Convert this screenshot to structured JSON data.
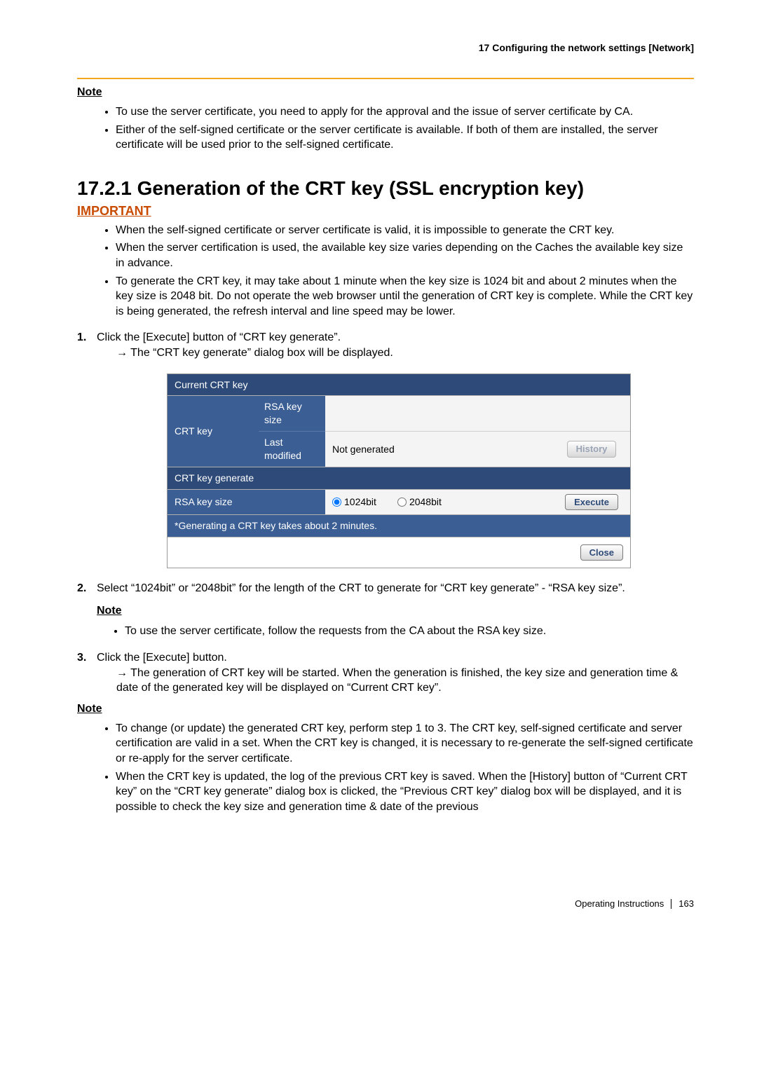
{
  "header": {
    "chapter": "17 Configuring the network settings [Network]"
  },
  "noteTop": {
    "heading": "Note",
    "items": [
      "To use the server certificate, you need to apply for the approval and the issue of server certificate by CA.",
      "Either of the self-signed certificate or the server certificate is available. If both of them are installed, the server certificate will be used prior to the self-signed certificate."
    ]
  },
  "section": {
    "number_title": "17.2.1  Generation of the CRT key (SSL encryption key)",
    "important": "IMPORTANT",
    "importantItems": [
      "When the self-signed certificate or server certificate is valid, it is impossible to generate the CRT key.",
      "When the server certification is used, the available key size varies depending on the Caches the available key size in advance.",
      "To generate the CRT key, it may take about 1 minute when the key size is 1024 bit and about 2 minutes when the key size is 2048 bit. Do not operate the web browser until the generation of CRT key is complete. While the CRT key is being generated, the refresh interval and line speed may be lower."
    ]
  },
  "step1": {
    "text": "Click the [Execute] button of “CRT key generate”.",
    "arrow": "The “CRT key generate” dialog box will be displayed."
  },
  "dialog": {
    "title": "Current CRT key",
    "rowLabel": "CRT key",
    "sub1": "RSA key size",
    "sub2": "Last modified",
    "val1": "",
    "val2": "Not generated",
    "historyBtn": "History",
    "genTitle": "CRT key generate",
    "rsaLabel": "RSA key size",
    "opt1": "1024bit",
    "opt2": "2048bit",
    "execBtn": "Execute",
    "genNote": "*Generating a CRT key takes about 2 minutes.",
    "closeBtn": "Close"
  },
  "step2": {
    "text": "Select “1024bit” or “2048bit” for the length of the CRT to generate for “CRT key generate” - “RSA key size”."
  },
  "noteMid": {
    "heading": "Note",
    "items": [
      "To use the server certificate, follow the requests from the CA about the RSA key size."
    ]
  },
  "step3": {
    "text": "Click the [Execute] button.",
    "arrow": "The generation of CRT key will be started. When the generation is finished, the key size and generation time & date of the generated key will be displayed on “Current CRT key”."
  },
  "noteBottom": {
    "heading": "Note",
    "items": [
      "To change (or update) the generated CRT key, perform step 1 to 3. The CRT key, self-signed certificate and server certification are valid in a set. When the CRT key is changed, it is necessary to re-generate the self-signed certificate or re-apply for the server certificate.",
      "When the CRT key is updated, the log of the previous CRT key is saved. When the [History] button of “Current CRT key” on the “CRT key generate” dialog box is clicked, the “Previous CRT key” dialog box will be displayed, and it is possible to check the key size and generation time & date of the previous"
    ]
  },
  "footer": {
    "label": "Operating Instructions",
    "page": "163"
  }
}
